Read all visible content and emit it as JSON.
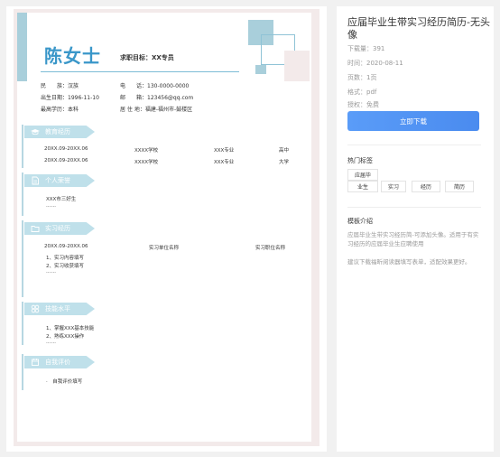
{
  "resume": {
    "name": "陈女士",
    "objective": "求职目标：XX专员",
    "info_rows": [
      [
        {
          "label": "民　　族：",
          "value": "汉族"
        },
        {
          "label": "电　　话：",
          "value": "130-0000-0000"
        }
      ],
      [
        {
          "label": "出生日期：",
          "value": "1996-11-10"
        },
        {
          "label": "邮　　箱：",
          "value": "123456@qq.com"
        }
      ],
      [
        {
          "label": "最高学历：",
          "value": "本科"
        },
        {
          "label": "居 住 地：",
          "value": "福建-福州市-鼓楼区"
        }
      ]
    ],
    "education": {
      "title": "教育经历",
      "rows": [
        [
          "20XX.09-20XX.06",
          "XXXX学校",
          "XXX专业",
          "高中"
        ],
        [
          "20XX.09-20XX.06",
          "XXXX学校",
          "XXX专业",
          "大学"
        ]
      ]
    },
    "honors": {
      "title": "个人荣誉",
      "lines": [
        "XXX市三好生",
        "……"
      ]
    },
    "internship": {
      "title": "实习经历",
      "row": [
        "20XX.09-20XX.06",
        "实习单位名称",
        "实习职位名称"
      ],
      "lines": [
        "1、实习内容填写",
        "2、实习收获填写",
        "……"
      ]
    },
    "skills": {
      "title": "技能水平",
      "lines": [
        "1、掌握XXX基本技能",
        "2、熟练XXX操作",
        "……"
      ]
    },
    "self_eval": {
      "title": "自我评价",
      "lines": [
        "·　自我评价填写"
      ]
    }
  },
  "sidebar": {
    "title": "应届毕业生带实习经历简历-无头像",
    "meta": [
      "下载量：391",
      "时间：2020-08-11",
      "页数：1页",
      "格式：pdf",
      "授权：免费"
    ],
    "download_label": "立即下载",
    "tags_heading": "热门标签",
    "tags": [
      "应届毕",
      "业生",
      "实习",
      "经历",
      "简历"
    ],
    "intro_heading": "模板介绍",
    "intro_paragraphs": [
      "应届毕业生带实习经历简-可添加头像。适用于有实习经历的应届毕业生应聘使用",
      "建议下载福昕阅读器填写表单，适配效果更好。"
    ]
  },
  "colors": {
    "accent": "#3a97c9",
    "section_banner": "#bfe0ea",
    "download_button": "#4a8bef"
  },
  "icons": [
    "graduation-cap-icon",
    "document-icon",
    "folder-icon",
    "puzzle-icon",
    "calendar-icon"
  ]
}
